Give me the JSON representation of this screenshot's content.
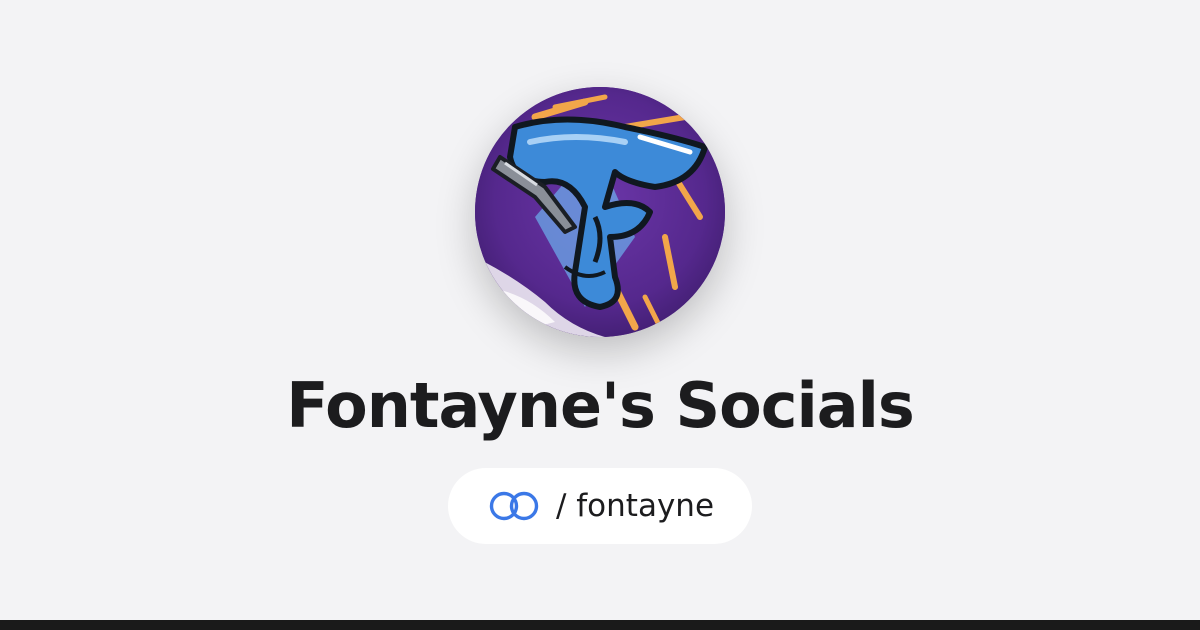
{
  "profile": {
    "title": "Fontayne's Socials",
    "handle_separator": "/",
    "handle": "fontayne",
    "display_handle": "/ fontayne",
    "avatar_icon": "fontayne-graffiti-f-avatar",
    "brand_icon": "linked-rings-logo-icon"
  },
  "colors": {
    "background": "#f3f3f5",
    "title": "#1c1c1e",
    "pill": "#ffffff",
    "brand_blue": "#3b78e7",
    "avatar_purple": "#5d2d96",
    "avatar_orange": "#f2a64a",
    "avatar_blue": "#3d8ad8",
    "bottom_bar": "#1a1a1a"
  }
}
